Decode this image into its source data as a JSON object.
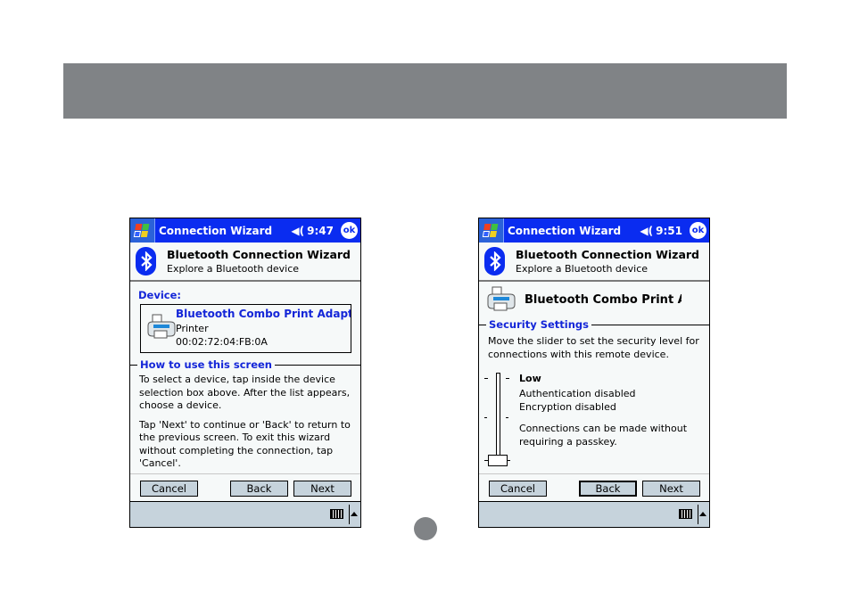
{
  "page": {
    "banner_color": "#808386",
    "page_indicator": "page-dot"
  },
  "screens": [
    {
      "titlebar": {
        "app_title": "Connection Wizard",
        "volume_icon": "speaker-icon",
        "time": "9:47",
        "ok_label": "ok"
      },
      "header": {
        "title": "Bluetooth Connection Wizard",
        "subtitle": "Explore a Bluetooth device"
      },
      "device_label": "Device:",
      "device": {
        "name": "Bluetooth Combo Print Adapte",
        "type": "Printer",
        "address": "00:02:72:04:FB:0A"
      },
      "howto": {
        "label": "How to use this screen",
        "paragraphs": [
          "To select a device, tap inside the device selection box above. After the list appears, choose a device.",
          "Tap 'Next' to continue or 'Back' to return to the previous screen. To exit this wizard without completing the connection, tap 'Cancel'."
        ]
      },
      "buttons": {
        "cancel": "Cancel",
        "back": "Back",
        "next": "Next"
      }
    },
    {
      "titlebar": {
        "app_title": "Connection Wizard",
        "volume_icon": "speaker-icon",
        "time": "9:51",
        "ok_label": "ok"
      },
      "header": {
        "title": "Bluetooth Connection Wizard",
        "subtitle": "Explore a Bluetooth device"
      },
      "device_name": "Bluetooth Combo Print Ac",
      "security": {
        "label": "Security Settings",
        "intro": "Move the slider to set the security level for connections with this remote device.",
        "slider_level_fraction": 0.0,
        "level_name": "Low",
        "details": [
          "Authentication disabled\nEncryption disabled",
          "Connections can be made without requiring a passkey."
        ]
      },
      "buttons": {
        "cancel": "Cancel",
        "back": "Back",
        "next": "Next",
        "focused": "back"
      }
    }
  ],
  "colors": {
    "titlebar": "#0a2cf0",
    "accent_text": "#1426d8",
    "button_bg": "#c6d3dc",
    "screen_bg": "#f6f9f9"
  }
}
